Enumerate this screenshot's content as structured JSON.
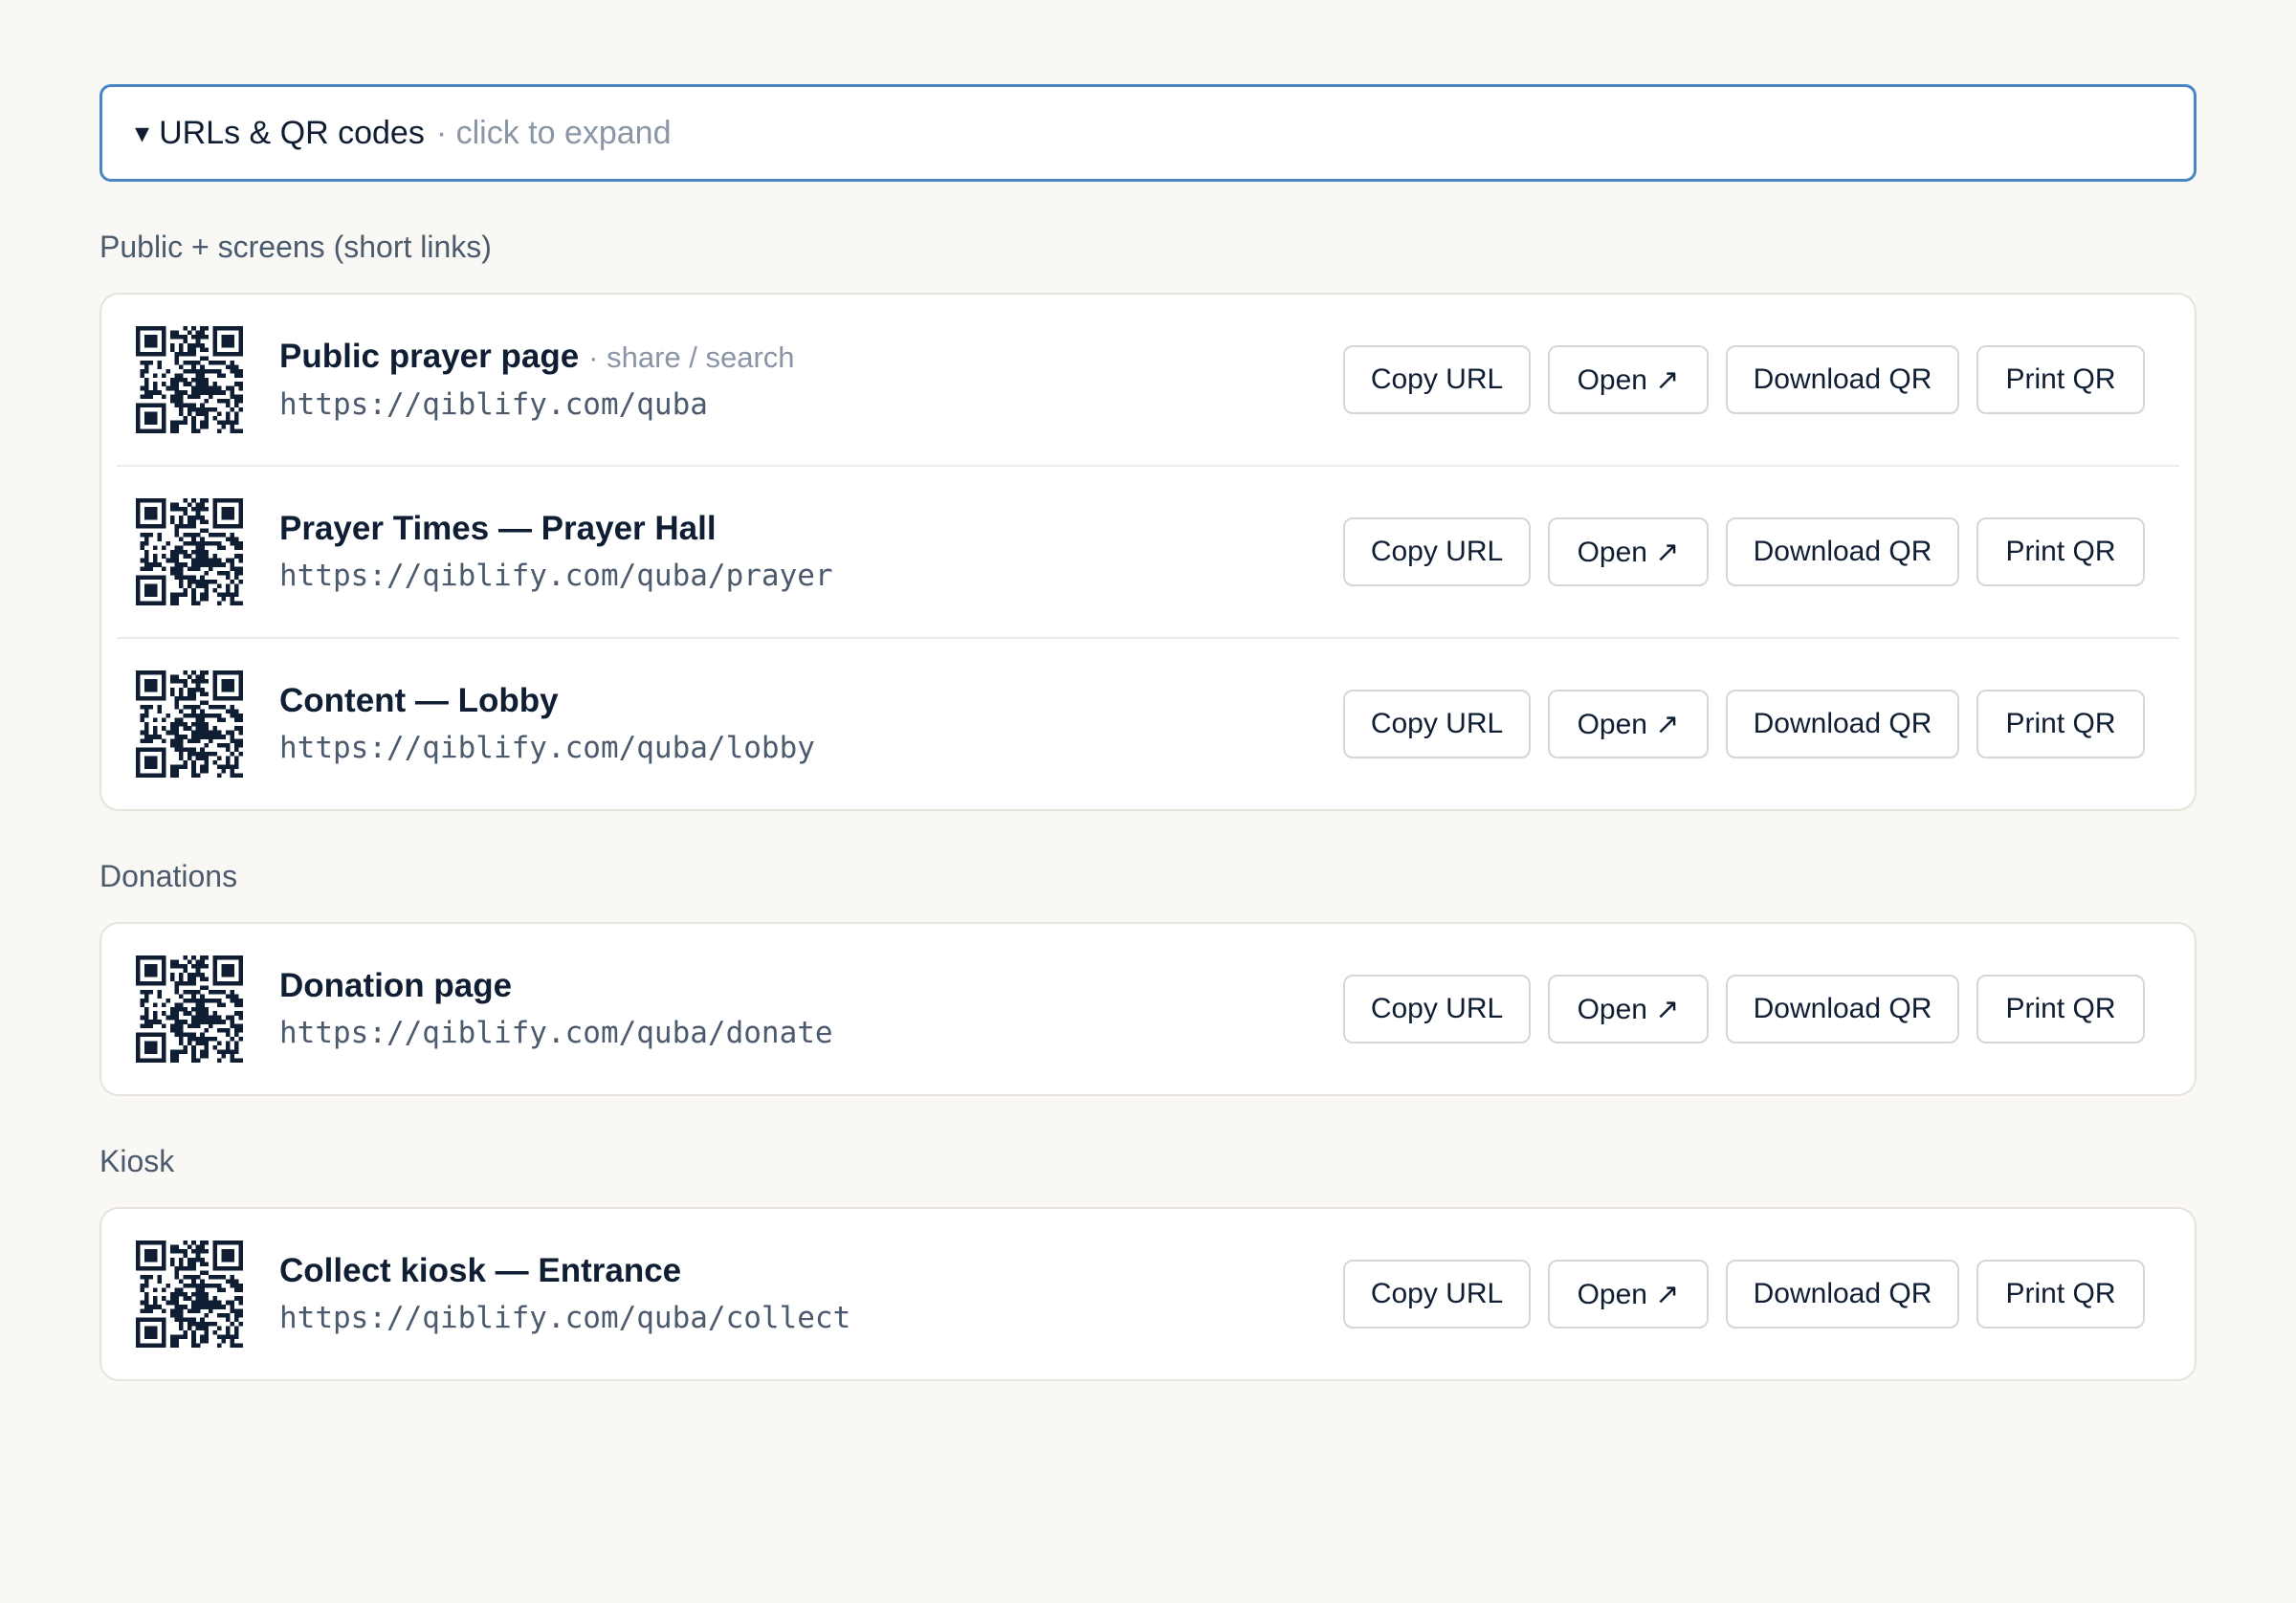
{
  "expander": {
    "arrow": "▾",
    "title": "URLs & QR codes",
    "hint": "· click to expand"
  },
  "sections": {
    "public": {
      "label": "Public + screens (short links)",
      "items": [
        {
          "title": "Public prayer page",
          "subtitle": "· share / search",
          "url": "https://qiblify.com/quba"
        },
        {
          "title": "Prayer Times — Prayer Hall",
          "url": "https://qiblify.com/quba/prayer"
        },
        {
          "title": "Content — Lobby",
          "url": "https://qiblify.com/quba/lobby"
        }
      ]
    },
    "donations": {
      "label": "Donations",
      "items": [
        {
          "title": "Donation page",
          "url": "https://qiblify.com/quba/donate"
        }
      ]
    },
    "kiosk": {
      "label": "Kiosk",
      "items": [
        {
          "title": "Collect kiosk — Entrance",
          "url": "https://qiblify.com/quba/collect"
        }
      ]
    }
  },
  "actions": {
    "copy": "Copy URL",
    "open": "Open ↗",
    "download": "Download QR",
    "print": "Print QR"
  },
  "qr": {
    "icon": "qr-code-icon",
    "color": "#0f1e33"
  }
}
